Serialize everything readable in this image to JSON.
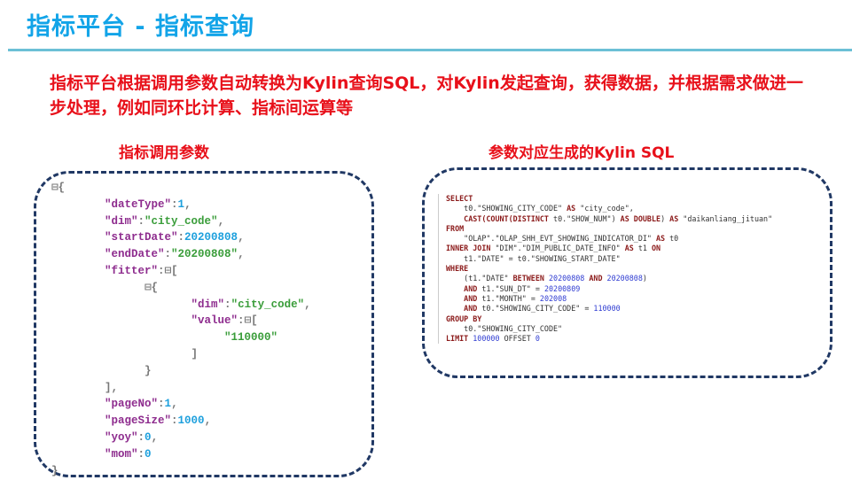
{
  "header": {
    "title": "指标平台 - 指标查询",
    "rule_color": "#6cc0d6"
  },
  "description": "指标平台根据调用参数自动转换为Kylin查询SQL，对Kylin发起查询，获得数据，并根据需求做进一步处理，例如同环比计算、指标间运算等",
  "left_panel": {
    "heading": "指标调用参数",
    "json_lines": [
      [
        [
          "p",
          "⊟{"
        ]
      ],
      [
        [
          "p",
          "        "
        ],
        [
          "k",
          "\"dateType\""
        ],
        [
          "p",
          ":"
        ],
        [
          "n",
          "1"
        ],
        [
          "p",
          ","
        ]
      ],
      [
        [
          "p",
          "        "
        ],
        [
          "k",
          "\"dim\""
        ],
        [
          "p",
          ":"
        ],
        [
          "s",
          "\"city_code\""
        ],
        [
          "p",
          ","
        ]
      ],
      [
        [
          "p",
          "        "
        ],
        [
          "k",
          "\"startDate\""
        ],
        [
          "p",
          ":"
        ],
        [
          "n",
          "20200808"
        ],
        [
          "p",
          ","
        ]
      ],
      [
        [
          "p",
          "        "
        ],
        [
          "k",
          "\"endDate\""
        ],
        [
          "p",
          ":"
        ],
        [
          "s",
          "\"20200808\""
        ],
        [
          "p",
          ","
        ]
      ],
      [
        [
          "p",
          "        "
        ],
        [
          "k",
          "\"fitter\""
        ],
        [
          "p",
          ":⊟["
        ]
      ],
      [
        [
          "p",
          "              ⊟{"
        ]
      ],
      [
        [
          "p",
          "                     "
        ],
        [
          "k",
          "\"dim\""
        ],
        [
          "p",
          ":"
        ],
        [
          "s",
          "\"city_code\""
        ],
        [
          "p",
          ","
        ]
      ],
      [
        [
          "p",
          "                     "
        ],
        [
          "k",
          "\"value\""
        ],
        [
          "p",
          ":⊟["
        ]
      ],
      [
        [
          "p",
          "                          "
        ],
        [
          "s",
          "\"110000\""
        ]
      ],
      [
        [
          "p",
          "                     ]"
        ]
      ],
      [
        [
          "p",
          "              }"
        ]
      ],
      [
        [
          "p",
          "        ],"
        ]
      ],
      [
        [
          "p",
          "        "
        ],
        [
          "k",
          "\"pageNo\""
        ],
        [
          "p",
          ":"
        ],
        [
          "n",
          "1"
        ],
        [
          "p",
          ","
        ]
      ],
      [
        [
          "p",
          "        "
        ],
        [
          "k",
          "\"pageSize\""
        ],
        [
          "p",
          ":"
        ],
        [
          "n",
          "1000"
        ],
        [
          "p",
          ","
        ]
      ],
      [
        [
          "p",
          "        "
        ],
        [
          "k",
          "\"yoy\""
        ],
        [
          "p",
          ":"
        ],
        [
          "n",
          "0"
        ],
        [
          "p",
          ","
        ]
      ],
      [
        [
          "p",
          "        "
        ],
        [
          "k",
          "\"mom\""
        ],
        [
          "p",
          ":"
        ],
        [
          "n",
          "0"
        ]
      ],
      [
        [
          "p",
          "}"
        ]
      ]
    ]
  },
  "right_panel": {
    "heading": "参数对应生成的Kylin SQL",
    "sql_lines": [
      [
        [
          "k",
          "SELECT"
        ]
      ],
      [
        [
          "s",
          "    t0.\"SHOWING_CITY_CODE\" "
        ],
        [
          "k",
          "AS"
        ],
        [
          "s",
          " \"city_code\","
        ]
      ],
      [
        [
          "s",
          "    "
        ],
        [
          "k",
          "CAST(COUNT(DISTINCT"
        ],
        [
          "s",
          " t0.\"SHOW_NUM\") "
        ],
        [
          "k",
          "AS DOUBLE"
        ],
        [
          "s",
          ") "
        ],
        [
          "k",
          "AS"
        ],
        [
          "s",
          " \"daikanliang_jituan\""
        ]
      ],
      [
        [
          "k",
          "FROM"
        ]
      ],
      [
        [
          "s",
          "    \"OLAP\".\"OLAP_SHH_EVT_SHOWING_INDICATOR_DI\" "
        ],
        [
          "k",
          "AS"
        ],
        [
          "s",
          " t0"
        ]
      ],
      [
        [
          "k",
          "INNER JOIN"
        ],
        [
          "s",
          " \"DIM\".\"DIM_PUBLIC_DATE_INFO\" "
        ],
        [
          "k",
          "AS"
        ],
        [
          "s",
          " t1 "
        ],
        [
          "k",
          "ON"
        ]
      ],
      [
        [
          "s",
          "    t1.\"DATE\" = t0.\"SHOWING_START_DATE\""
        ]
      ],
      [
        [
          "k",
          "WHERE"
        ]
      ],
      [
        [
          "s",
          "    (t1.\"DATE\" "
        ],
        [
          "k",
          "BETWEEN"
        ],
        [
          "n",
          " 20200808 "
        ],
        [
          "k",
          "AND"
        ],
        [
          "n",
          " 20200808"
        ],
        [
          "s",
          ")"
        ]
      ],
      [
        [
          "s",
          "    "
        ],
        [
          "k",
          "AND"
        ],
        [
          "s",
          " t1.\"SUN_DT\" = "
        ],
        [
          "n",
          "20200809"
        ]
      ],
      [
        [
          "s",
          "    "
        ],
        [
          "k",
          "AND"
        ],
        [
          "s",
          " t1.\"MONTH\" = "
        ],
        [
          "n",
          "202008"
        ]
      ],
      [
        [
          "s",
          "    "
        ],
        [
          "k",
          "AND"
        ],
        [
          "s",
          " t0.\"SHOWING_CITY_CODE\" = "
        ],
        [
          "n",
          "110000"
        ]
      ],
      [
        [
          "k",
          "GROUP BY"
        ]
      ],
      [
        [
          "s",
          "    t0.\"SHOWING_CITY_CODE\""
        ]
      ],
      [
        [
          "k",
          "LIMIT"
        ],
        [
          "n",
          " 100000 "
        ],
        [
          "s",
          "OFFSET "
        ],
        [
          "n",
          "0"
        ]
      ]
    ]
  },
  "colors": {
    "title": "#12a4e8",
    "text_red": "#e8101a",
    "box_border": "#203864"
  }
}
